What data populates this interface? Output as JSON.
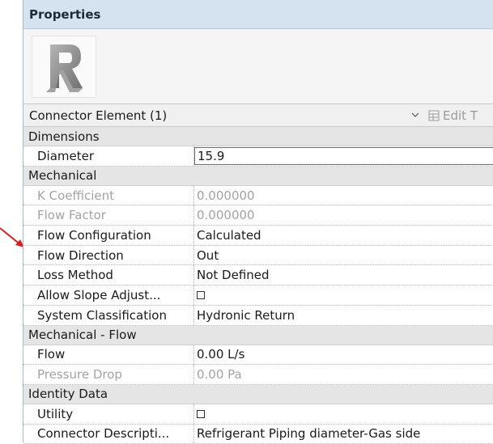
{
  "panel": {
    "title": "Properties"
  },
  "type_selector": {
    "value": "Connector Element (1)",
    "edit_type_label": "Edit T"
  },
  "colors": {
    "title_bar": "#d5e3f1",
    "group_header": "#e5e5e5",
    "arrow": "#d62020",
    "logo": "#8e8e8e"
  },
  "icons": {
    "logo": "revit-r-logo",
    "dropdown": "chevron-down-icon",
    "edit": "edit-type-icon",
    "pointer": "arrow-icon"
  },
  "groups": {
    "dimensions": {
      "label": "Dimensions",
      "rows": [
        {
          "name": "Diameter",
          "value": "15.9"
        }
      ]
    },
    "mechanical": {
      "label": "Mechanical",
      "rows": [
        {
          "name": "K Coefficient",
          "value": "0.000000"
        },
        {
          "name": "Flow Factor",
          "value": "0.000000"
        },
        {
          "name": "Flow Configuration",
          "value": "Calculated"
        },
        {
          "name": "Flow Direction",
          "value": "Out"
        },
        {
          "name": "Loss Method",
          "value": "Not Defined"
        },
        {
          "name": "Allow Slope Adjust...",
          "value": false
        },
        {
          "name": "System Classification",
          "value": "Hydronic Return"
        }
      ]
    },
    "mechanical_flow": {
      "label": "Mechanical - Flow",
      "rows": [
        {
          "name": "Flow",
          "value": "0.00 L/s"
        },
        {
          "name": "Pressure Drop",
          "value": "0.00 Pa"
        }
      ]
    },
    "identity_data": {
      "label": "Identity Data",
      "rows": [
        {
          "name": "Utility",
          "value": false
        },
        {
          "name": "Connector Descripti...",
          "value": "Refrigerant Piping diameter-Gas side"
        }
      ]
    }
  }
}
